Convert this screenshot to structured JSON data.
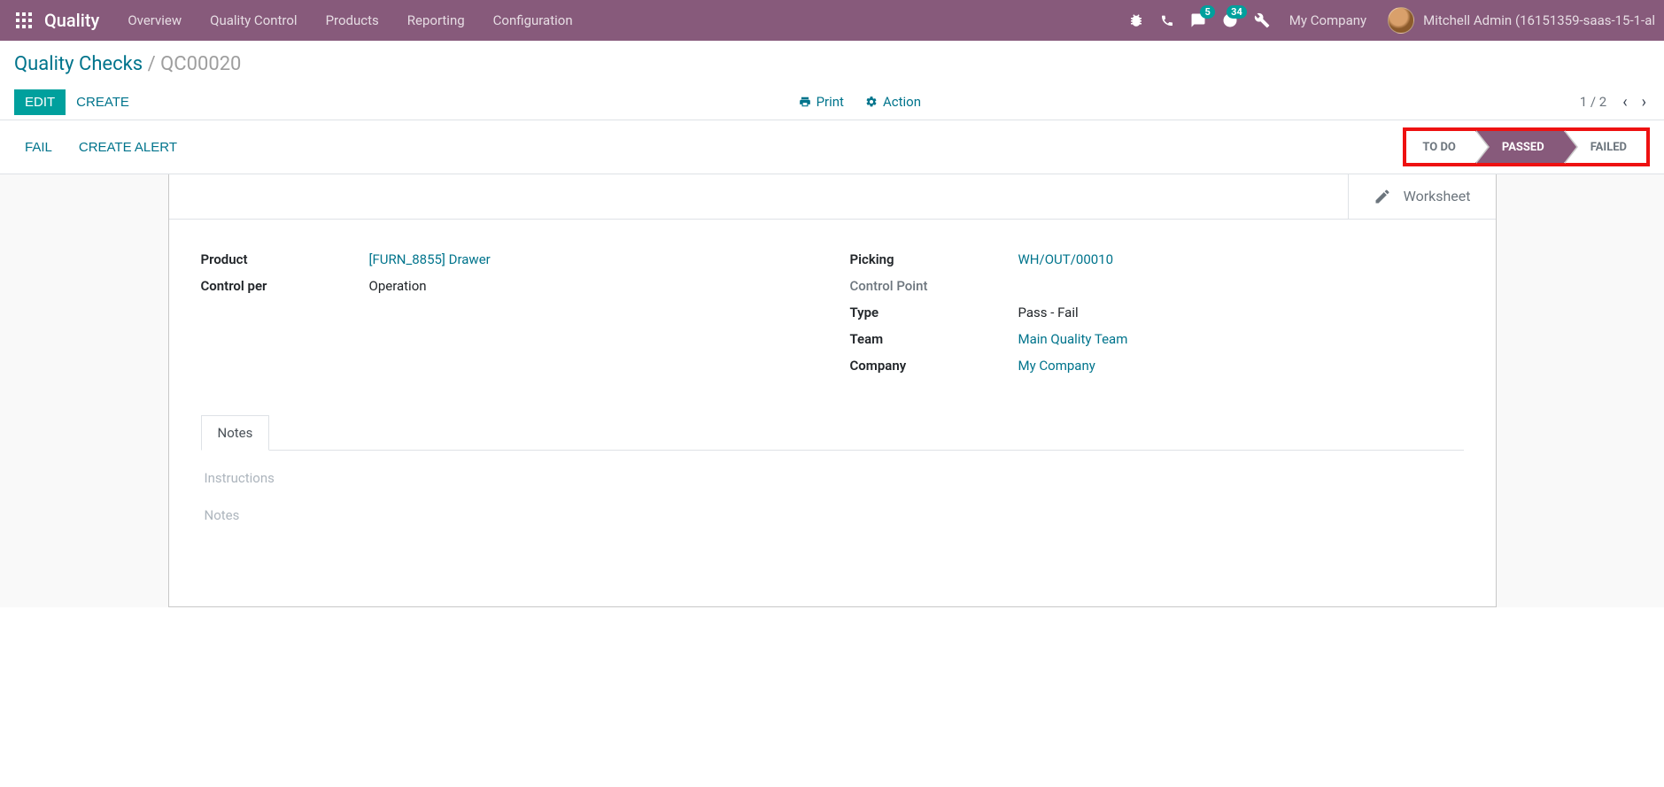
{
  "topbar": {
    "brand": "Quality",
    "nav": [
      "Overview",
      "Quality Control",
      "Products",
      "Reporting",
      "Configuration"
    ],
    "messages_badge": "5",
    "activities_badge": "34",
    "company": "My Company",
    "user": "Mitchell Admin (16151359-saas-15-1-al"
  },
  "breadcrumb": {
    "parent": "Quality Checks",
    "current": "QC00020"
  },
  "control_panel": {
    "edit": "Edit",
    "create": "Create",
    "print": "Print",
    "action": "Action",
    "pager": "1 / 2"
  },
  "status_actions": {
    "fail": "Fail",
    "create_alert": "Create Alert"
  },
  "statusbar": {
    "todo": "To Do",
    "passed": "Passed",
    "failed": "Failed"
  },
  "button_box": {
    "worksheet": "Worksheet"
  },
  "fields": {
    "product_label": "Product",
    "product_value": "[FURN_8855] Drawer",
    "control_per_label": "Control per",
    "control_per_value": "Operation",
    "picking_label": "Picking",
    "picking_value": "WH/OUT/00010",
    "control_point_label": "Control Point",
    "type_label": "Type",
    "type_value": "Pass - Fail",
    "team_label": "Team",
    "team_value": "Main Quality Team",
    "company_label": "Company",
    "company_value": "My Company"
  },
  "tabs": {
    "notes": "Notes"
  },
  "notes_tab": {
    "instructions_placeholder": "Instructions",
    "notes_placeholder": "Notes"
  }
}
